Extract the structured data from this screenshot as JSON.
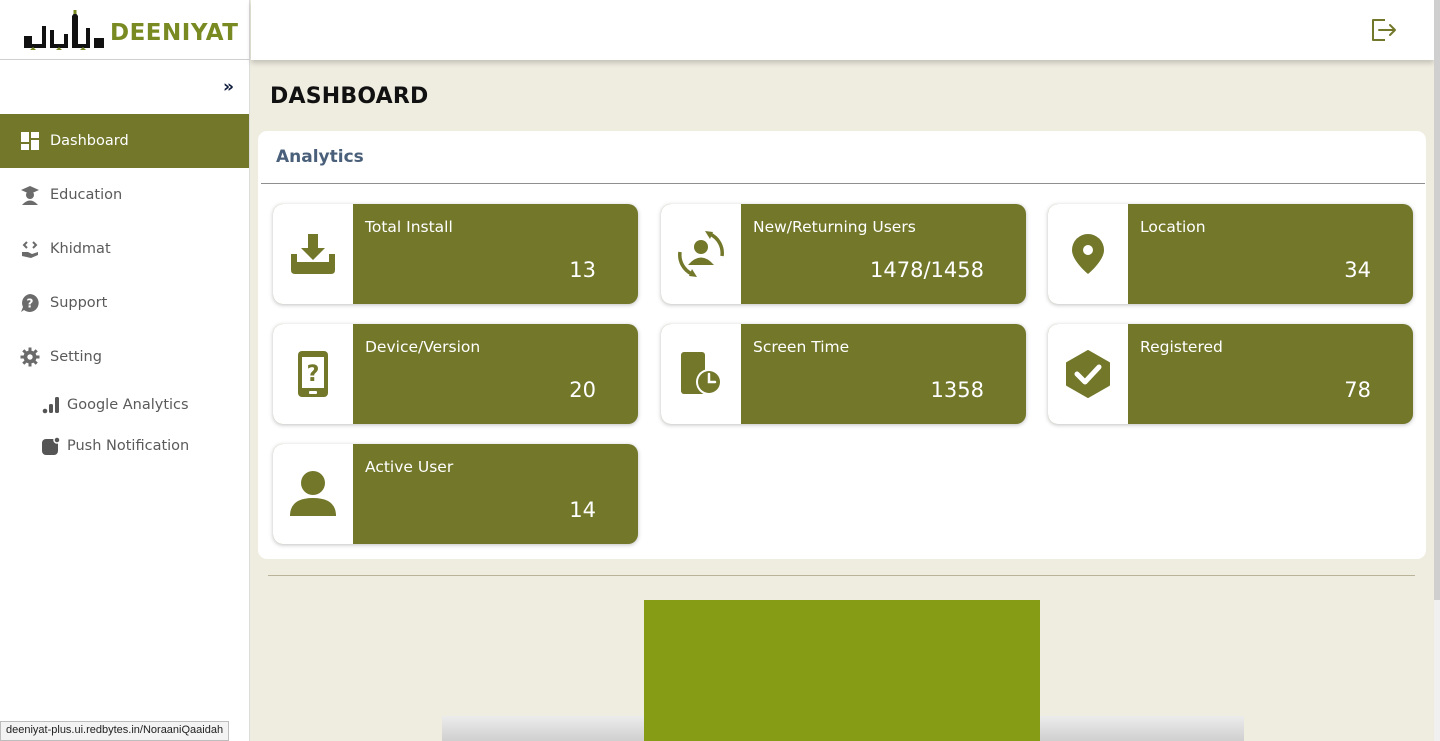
{
  "brand": {
    "logo_text": "DEENIYAT",
    "brand_color": "#72772a",
    "accent_color": "#869c14"
  },
  "sidebar": {
    "collapse_icon": "double-chevron-right-icon",
    "collapse_glyph": "»",
    "items": [
      {
        "label": "Dashboard",
        "icon": "dashboard-grid-icon",
        "active": true
      },
      {
        "label": "Education",
        "icon": "graduate-icon"
      },
      {
        "label": "Khidmat",
        "icon": "helping-hand-icon"
      },
      {
        "label": "Support",
        "icon": "help-circle-icon"
      },
      {
        "label": "Setting",
        "icon": "gear-icon"
      }
    ],
    "sub_items": [
      {
        "label": "Google Analytics",
        "icon": "bar-chart-icon"
      },
      {
        "label": "Push Notification",
        "icon": "notification-icon"
      }
    ]
  },
  "header": {
    "logout_icon": "logout-icon"
  },
  "main": {
    "page_title": "DASHBOARD",
    "panel_title": "Analytics",
    "cards": [
      {
        "label": "Total Install",
        "value": "13",
        "icon": "download-tray-icon"
      },
      {
        "label": "New/Returning Users",
        "value": "1478/1458",
        "icon": "user-refresh-icon"
      },
      {
        "label": "Location",
        "value": "34",
        "icon": "map-pin-icon"
      },
      {
        "label": "Device/Version",
        "value": "20",
        "icon": "device-question-icon"
      },
      {
        "label": "Screen Time",
        "value": "1358",
        "icon": "device-clock-icon"
      },
      {
        "label": "Registered",
        "value": "78",
        "icon": "check-badge-icon"
      },
      {
        "label": "Active User",
        "value": "14",
        "icon": "user-icon"
      }
    ]
  },
  "status_bar": {
    "url": "deeniyat-plus.ui.redbytes.in/NoraaniQaaidah"
  }
}
